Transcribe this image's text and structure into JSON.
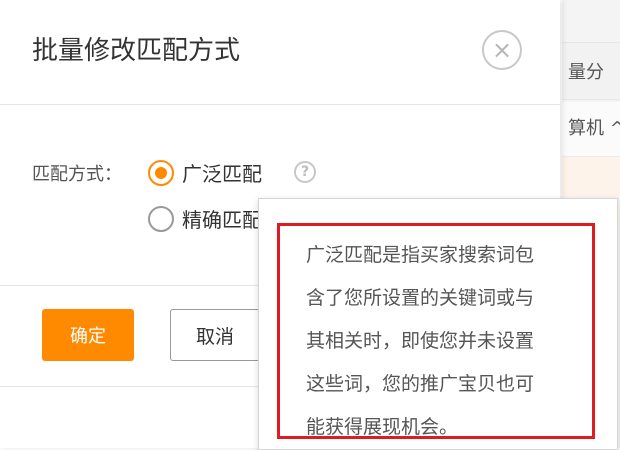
{
  "background": {
    "header_text": "量分",
    "row_text": "算机 ^"
  },
  "dialog": {
    "title": "批量修改匹配方式",
    "close_glyph": "×",
    "match_label": "匹配方式：",
    "options": [
      {
        "label": "广泛匹配",
        "checked": true
      },
      {
        "label": "精确匹配",
        "checked": false
      }
    ],
    "help_glyph": "?",
    "ok_label": "确定",
    "cancel_label": "取消"
  },
  "tooltip": {
    "lines": [
      "广泛匹配是指买家搜索词包",
      "含了您所设置的关键词或与",
      "其相关时，即使您并未设置",
      "这些词，您的推广宝贝也可",
      "能获得展现机会。"
    ]
  },
  "colors": {
    "accent": "#ff8a00",
    "highlight_border": "#e11b22"
  }
}
